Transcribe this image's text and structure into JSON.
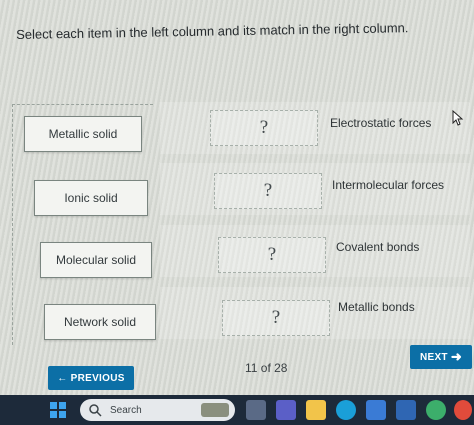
{
  "instruction": "Select each item in the left column and its match in the right column.",
  "left_items": [
    {
      "label": "Metallic solid"
    },
    {
      "label": "Ionic solid"
    },
    {
      "label": "Molecular solid"
    },
    {
      "label": "Network solid"
    }
  ],
  "slots": [
    {
      "value": "?"
    },
    {
      "value": "?"
    },
    {
      "value": "?"
    },
    {
      "value": "?"
    }
  ],
  "right_items": [
    {
      "label": "Electrostatic forces"
    },
    {
      "label": "Intermolecular forces"
    },
    {
      "label": "Covalent bonds"
    },
    {
      "label": "Metallic bonds"
    }
  ],
  "navigation": {
    "previous_label": "PREVIOUS",
    "next_label": "NEXT",
    "counter": "11 of 28"
  },
  "taskbar": {
    "search_placeholder": "Search"
  },
  "colors": {
    "accent": "#0c6fa6",
    "taskbar": "#1d2a3a"
  }
}
